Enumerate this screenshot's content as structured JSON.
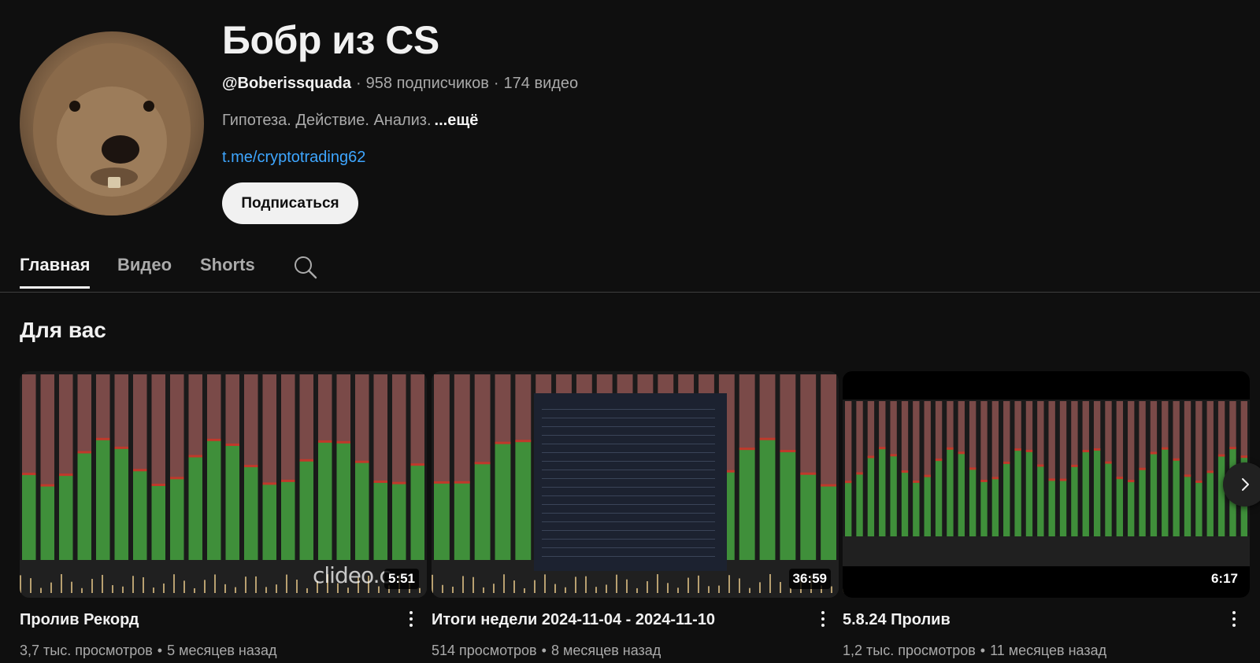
{
  "channel": {
    "name": "Бобр из CS",
    "handle": "@Boberissquada",
    "subscribers": "958 подписчиков",
    "videos_count": "174 видео",
    "separator": "·",
    "description": "Гипотеза. Действие. Анализ.",
    "more_label": "...ещё",
    "link": "t.me/cryptotrading62",
    "subscribe_label": "Подписаться"
  },
  "tabs": [
    {
      "label": "Главная",
      "active": true
    },
    {
      "label": "Видео",
      "active": false
    },
    {
      "label": "Shorts",
      "active": false
    }
  ],
  "section": {
    "title": "Для вас"
  },
  "videos": [
    {
      "title": "Пролив Рекорд",
      "duration": "5:51",
      "views": "3,7 тыс. просмотров",
      "age": "5 месяцев назад",
      "watermark": "clideo.c"
    },
    {
      "title": "Итоги недели 2024-11-04 - 2024-11-10",
      "duration": "36:59",
      "views": "514 просмотров",
      "age": "8 месяцев назад"
    },
    {
      "title": "5.8.24 Пролив",
      "duration": "6:17",
      "views": "1,2 тыс. просмотров",
      "age": "11 месяцев назад"
    }
  ],
  "meta_separator": "•",
  "icons": {
    "search": "search-icon",
    "more": "more-vert-icon",
    "next": "chevron-right-icon"
  },
  "colors": {
    "background": "#0f0f0f",
    "link": "#3ea6ff",
    "chart_green": "#3f8f3a",
    "chart_red": "#7a4a48"
  }
}
